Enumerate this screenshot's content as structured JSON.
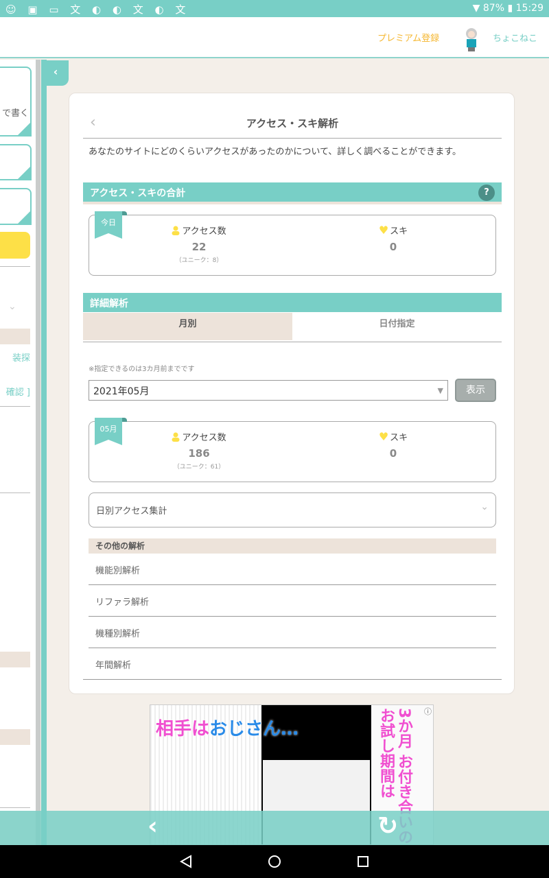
{
  "status_bar": {
    "notification_icons": "☺ ▣ ▭ 文 ◐ ◐ 文 ◐ 文",
    "battery": "87%",
    "time": "15:29"
  },
  "header": {
    "premium_label": "プレミアム登録",
    "username": "ちょこねこ"
  },
  "sidebar": {
    "card_text": "で書く",
    "link1": "装探",
    "link2": "確認 ]"
  },
  "page": {
    "title": "アクセス・スキ解析",
    "description": "あなたのサイトにどのくらいアクセスがあったのかについて、詳しく調べることができます。",
    "total_section": {
      "title": "アクセス・スキの合計",
      "help": "?",
      "today": {
        "ribbon": "今日",
        "access_label": "アクセス数",
        "access_count": "22",
        "unique": "（ユニーク：8）",
        "like_label": "スキ",
        "like_count": "0"
      }
    },
    "detail_section": {
      "title": "詳細解析",
      "tabs": [
        {
          "label": "月別",
          "active": true
        },
        {
          "label": "日付指定",
          "active": false
        }
      ],
      "note": "※指定できるのは3カ月前までです",
      "selected_month": "2021年05月",
      "show_button": "表示",
      "month": {
        "ribbon": "05月",
        "access_label": "アクセス数",
        "access_count": "186",
        "unique": "（ユニーク：61）",
        "like_label": "スキ",
        "like_count": "0"
      },
      "daily_accordion": "日別アクセス集計"
    },
    "other_section": {
      "title": "その他の解析",
      "items": [
        "機能別解析",
        "リファラ解析",
        "機種別解析",
        "年間解析"
      ]
    }
  },
  "ad": {
    "headline_a": "相手は",
    "headline_b": "おじさん…",
    "side_text": "3か月 お付き合いのお試し期間は"
  },
  "colors": {
    "accent": "#78cfc6",
    "premium": "#f5b731",
    "like": "#fde047"
  }
}
